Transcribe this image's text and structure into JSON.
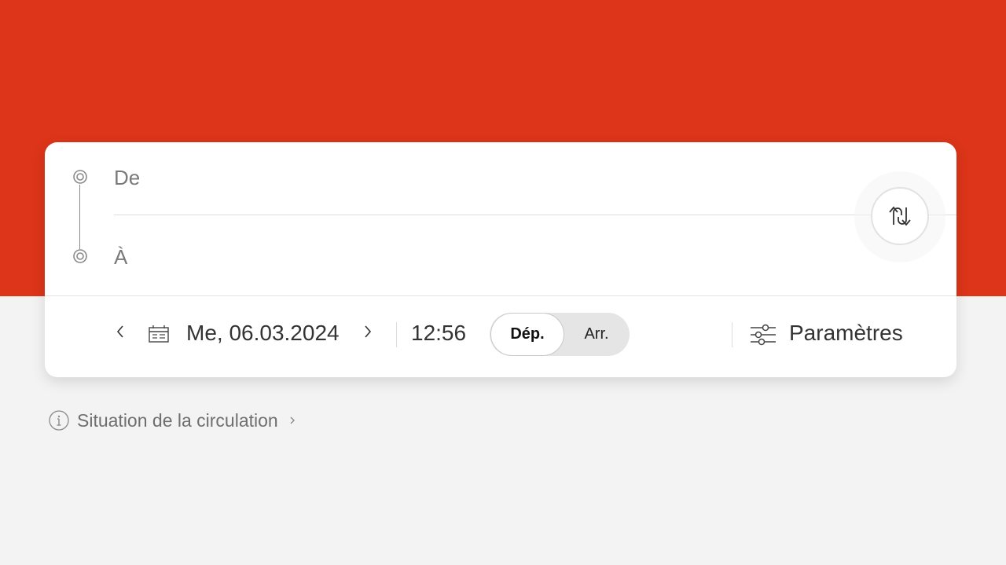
{
  "search": {
    "from_placeholder": "De",
    "to_placeholder": "À"
  },
  "datetime": {
    "date": "Me, 06.03.2024",
    "time": "12:56",
    "mode_departure": "Dép.",
    "mode_arrival": "Arr.",
    "selected_mode": "departure"
  },
  "settings": {
    "label": "Paramètres"
  },
  "traffic": {
    "label": "Situation de la circulation"
  },
  "icons": [
    "origin-dot-icon",
    "destination-dot-icon",
    "swap-icon",
    "chevron-left-icon",
    "calendar-icon",
    "chevron-right-icon",
    "sliders-icon",
    "info-icon",
    "chevron-right-small-icon"
  ],
  "colors": {
    "brand_red": "#dc3519",
    "background": "#f3f3f3",
    "card": "#ffffff"
  }
}
